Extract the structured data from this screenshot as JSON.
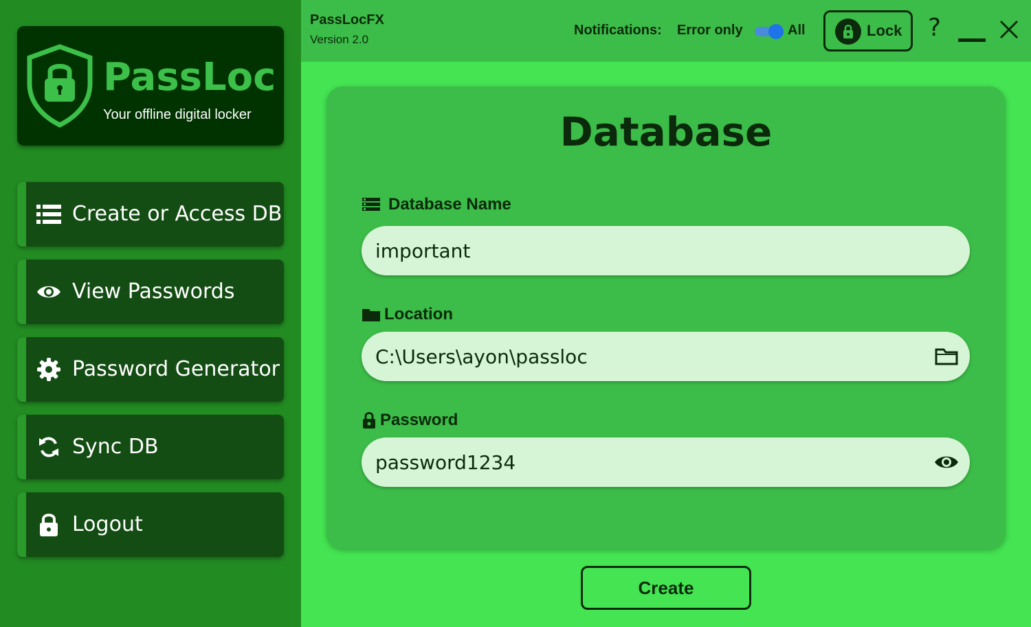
{
  "brand": {
    "title": "PassLoc",
    "subtitle": "Your offline digital locker"
  },
  "sidebar": {
    "items": [
      {
        "label": "Create or Access DB",
        "icon": "list-icon"
      },
      {
        "label": "View Passwords",
        "icon": "eye-icon"
      },
      {
        "label": "Password Generator",
        "icon": "gear-icon"
      },
      {
        "label": "Sync DB",
        "icon": "sync-icon"
      },
      {
        "label": "Logout",
        "icon": "lock-icon"
      }
    ]
  },
  "topbar": {
    "app_name": "PassLocFX",
    "version": "Version 2.0",
    "notifications_label": "Notifications:",
    "notifications_option_off": "Error only",
    "notifications_option_on": "All",
    "lock_label": "Lock",
    "help_label": "?"
  },
  "card": {
    "title": "Database",
    "db_name_label": "Database Name",
    "db_name_value": "important",
    "location_label": "Location",
    "location_value": "C:\\Users\\ayon\\passloc",
    "password_label": "Password",
    "password_value": "password1234"
  },
  "actions": {
    "create_label": "Create"
  },
  "colors": {
    "sidebar_bg": "#228b22",
    "brand_bg": "#003300",
    "nav_bg": "#144d14",
    "topbar_bg": "#3cbc48",
    "main_bg": "#44e452",
    "field_bg": "#d6f5d6",
    "text_dark": "#0b2a0b",
    "toggle_blue": "#1e73e8"
  }
}
